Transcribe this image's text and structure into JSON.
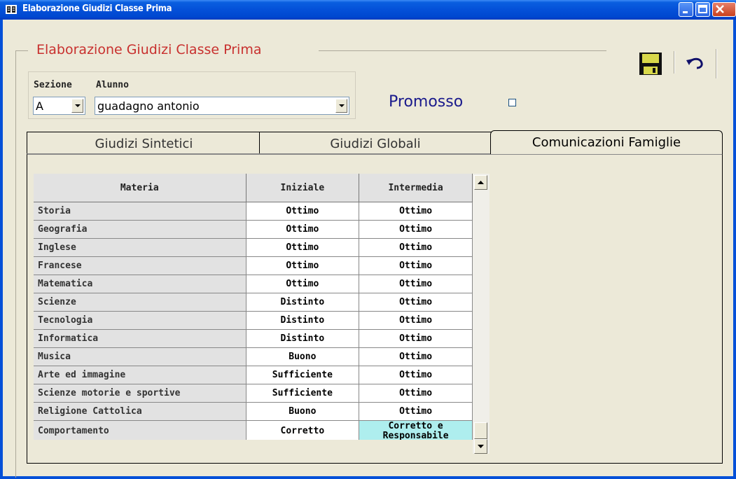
{
  "window": {
    "title": "Elaborazione Giudizi Classe Prima"
  },
  "group": {
    "title": "Elaborazione Giudizi Classe Prima"
  },
  "toolbar": {
    "save_icon": "floppy-disk",
    "undo_icon": "undo-arrow"
  },
  "selection": {
    "sezione_label": "Sezione",
    "sezione_value": "A",
    "alunno_label": "Alunno",
    "alunno_value": "guadagno antonio"
  },
  "promosso": {
    "label": "Promosso",
    "checked": false
  },
  "tabs": [
    {
      "label": "Giudizi Sintetici"
    },
    {
      "label": "Giudizi Globali"
    },
    {
      "label": "Comunicazioni Famiglie",
      "active": true
    }
  ],
  "grid": {
    "columns": [
      "Materia",
      "Iniziale",
      "Intermedia"
    ],
    "rows": [
      [
        "Storia",
        "Ottimo",
        "Ottimo"
      ],
      [
        "Geografia",
        "Ottimo",
        "Ottimo"
      ],
      [
        "Inglese",
        "Ottimo",
        "Ottimo"
      ],
      [
        "Francese",
        "Ottimo",
        "Ottimo"
      ],
      [
        "Matematica",
        "Ottimo",
        "Ottimo"
      ],
      [
        "Scienze",
        "Distinto",
        "Ottimo"
      ],
      [
        "Tecnologia",
        "Distinto",
        "Ottimo"
      ],
      [
        "Informatica",
        "Distinto",
        "Ottimo"
      ],
      [
        "Musica",
        "Buono",
        "Ottimo"
      ],
      [
        "Arte ed immagine",
        "Sufficiente",
        "Ottimo"
      ],
      [
        "Scienze motorie e sportive",
        "Sufficiente",
        "Ottimo"
      ],
      [
        "Religione Cattolica",
        "Buono",
        "Ottimo"
      ],
      [
        "Comportamento",
        "Corretto",
        "Corretto e Responsabile"
      ]
    ],
    "highlight_color": "#aeeeee"
  },
  "colors": {
    "group_title": "#c8302e",
    "promosso": "#1a1a8c",
    "titlebar": "#0450d8"
  }
}
